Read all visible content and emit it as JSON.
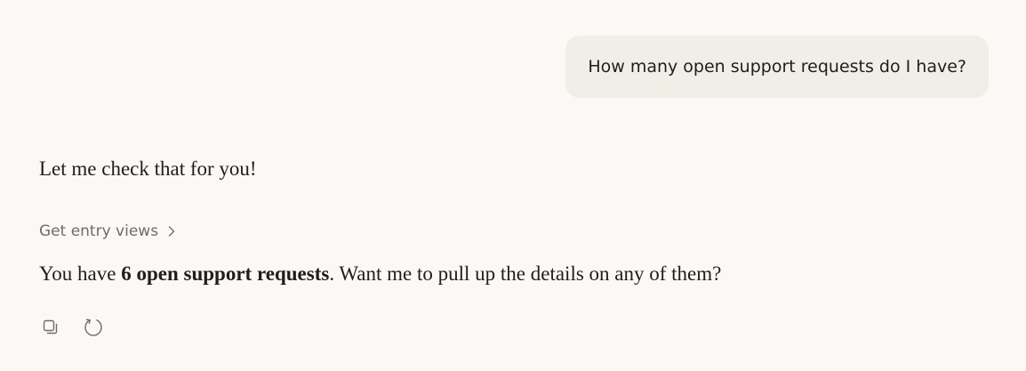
{
  "user_message": {
    "text": "How many open support requests do I have?"
  },
  "assistant": {
    "intro": "Let me check that for you!",
    "tool_call": {
      "label": "Get entry views",
      "icon": "chevron-right-icon"
    },
    "answer": {
      "prefix": "You have ",
      "emphasis": "6 open support requests",
      "suffix": ". Want me to pull up the details on any of them?"
    },
    "actions": [
      {
        "name": "copy",
        "icon": "copy-icon"
      },
      {
        "name": "retry",
        "icon": "retry-icon"
      }
    ]
  },
  "colors": {
    "background": "#faf9f5",
    "user_bubble": "#f0eee6",
    "text": "#1f1e1b",
    "muted": "#6f6d66"
  }
}
